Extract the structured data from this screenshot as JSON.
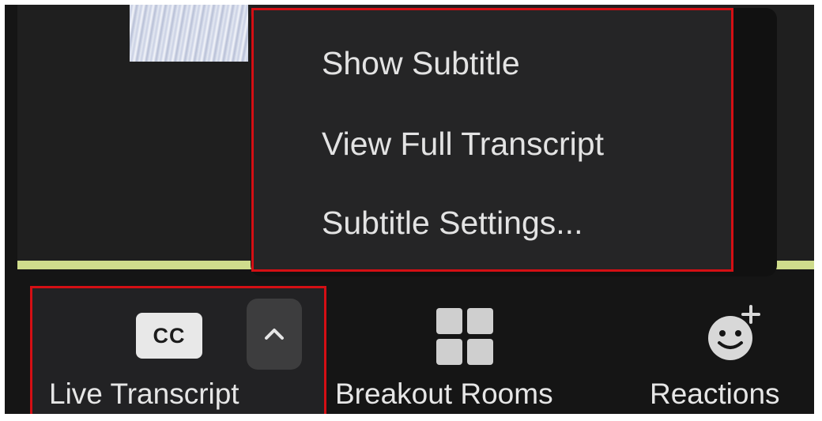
{
  "menu": {
    "items": [
      {
        "label": "Show Subtitle"
      },
      {
        "label": "View Full Transcript"
      },
      {
        "label": "Subtitle Settings..."
      }
    ]
  },
  "toolbar": {
    "live_transcript": {
      "cc_text": "CC",
      "label": "Live Transcript",
      "icon": "chevron-up-icon"
    },
    "breakout_rooms": {
      "label": "Breakout Rooms",
      "icon": "grid-icon"
    },
    "reactions": {
      "label": "Reactions",
      "icon": "smiley-plus-icon"
    }
  },
  "colors": {
    "highlight": "#d40f14",
    "menu_bg": "#252526",
    "toolbar_bg": "#151515",
    "accent_line": "#cfdc8c"
  }
}
